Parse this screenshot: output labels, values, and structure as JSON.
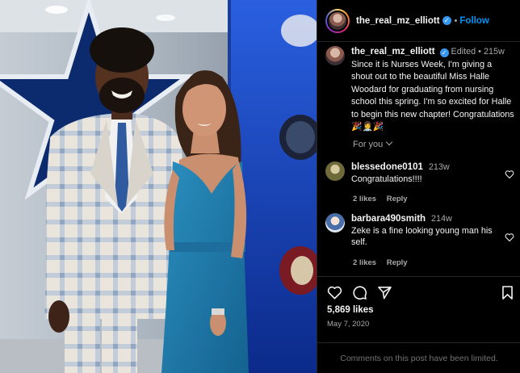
{
  "post": {
    "username": "the_real_mz_elliott",
    "follow_label": "Follow",
    "separator": "•",
    "caption": {
      "edited_label": "Edited",
      "age": "215w",
      "text": "Since it is Nurses Week, I'm giving a shout out to the beautiful Miss Halle Woodard for graduating from nursing school this spring. I'm so excited for Halle to begin this new chapter! Congratulations 🎉👩‍⚕️🎉"
    },
    "for_you_label": "For you",
    "comments": [
      {
        "username": "blessedone0101",
        "age": "213w",
        "text": "Congratulations!!!!",
        "likes_label": "2 likes",
        "reply_label": "Reply"
      },
      {
        "username": "barbara490smith",
        "age": "214w",
        "text": "Zeke is a fine looking young man his self.",
        "likes_label": "2 likes",
        "reply_label": "Reply"
      }
    ],
    "likes": "5,869 likes",
    "date": "May 7, 2020",
    "limited_notice": "Comments on this post have been limited."
  },
  "icons": [
    "heart-icon",
    "comment-icon",
    "share-icon",
    "bookmark-icon",
    "verified-badge-icon",
    "chevron-down-icon"
  ],
  "colors": {
    "background": "#000000",
    "follow_blue": "#0095f6",
    "verified_blue": "#3897f0",
    "muted_text": "#a8a8a8",
    "divider": "#262626"
  }
}
